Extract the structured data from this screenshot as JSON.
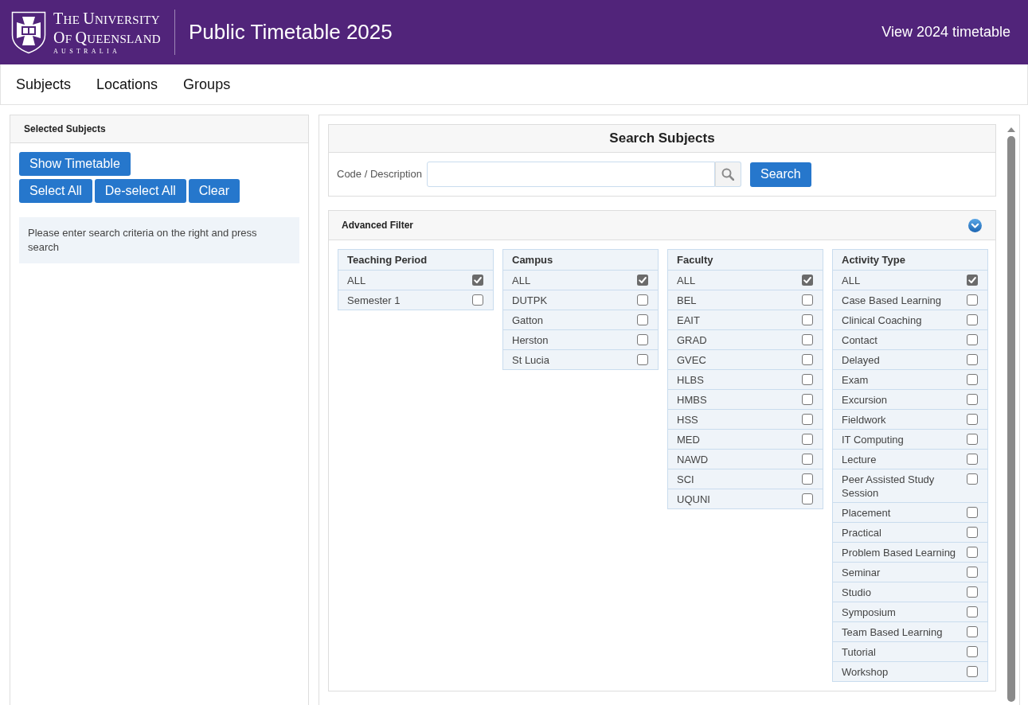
{
  "header": {
    "wordmark": [
      "THE UNIVERSITY",
      "OF QUEENSLAND",
      "AUSTRALIA"
    ],
    "title": "Public Timetable 2025",
    "link": "View 2024 timetable"
  },
  "nav": [
    "Subjects",
    "Locations",
    "Groups"
  ],
  "selected_subjects": {
    "title": "Selected Subjects",
    "button_rows": [
      [
        "Show Timetable"
      ],
      [
        "Select All",
        "De-select All",
        "Clear"
      ]
    ],
    "message": "Please enter search criteria on the right and press search"
  },
  "search": {
    "title": "Search Subjects",
    "label": "Code / Description",
    "button": "Search"
  },
  "advanced_filter": {
    "title": "Advanced Filter",
    "expanded": true,
    "filters": [
      {
        "title": "Teaching Period",
        "options": [
          {
            "label": "ALL",
            "checked": true
          },
          {
            "label": "Semester 1",
            "checked": false
          }
        ]
      },
      {
        "title": "Campus",
        "options": [
          {
            "label": "ALL",
            "checked": true
          },
          {
            "label": "DUTPK",
            "checked": false
          },
          {
            "label": "Gatton",
            "checked": false
          },
          {
            "label": "Herston",
            "checked": false
          },
          {
            "label": "St Lucia",
            "checked": false
          }
        ]
      },
      {
        "title": "Faculty",
        "options": [
          {
            "label": "ALL",
            "checked": true
          },
          {
            "label": "BEL",
            "checked": false
          },
          {
            "label": "EAIT",
            "checked": false
          },
          {
            "label": "GRAD",
            "checked": false
          },
          {
            "label": "GVEC",
            "checked": false
          },
          {
            "label": "HLBS",
            "checked": false
          },
          {
            "label": "HMBS",
            "checked": false
          },
          {
            "label": "HSS",
            "checked": false
          },
          {
            "label": "MED",
            "checked": false
          },
          {
            "label": "NAWD",
            "checked": false
          },
          {
            "label": "SCI",
            "checked": false
          },
          {
            "label": "UQUNI",
            "checked": false
          }
        ]
      },
      {
        "title": "Activity Type",
        "options": [
          {
            "label": "ALL",
            "checked": true
          },
          {
            "label": "Case Based Learning",
            "checked": false
          },
          {
            "label": "Clinical Coaching",
            "checked": false
          },
          {
            "label": "Contact",
            "checked": false
          },
          {
            "label": "Delayed",
            "checked": false
          },
          {
            "label": "Exam",
            "checked": false
          },
          {
            "label": "Excursion",
            "checked": false
          },
          {
            "label": "Fieldwork",
            "checked": false
          },
          {
            "label": "IT Computing",
            "checked": false
          },
          {
            "label": "Lecture",
            "checked": false
          },
          {
            "label": "Peer Assisted Study Session",
            "checked": false
          },
          {
            "label": "Placement",
            "checked": false
          },
          {
            "label": "Practical",
            "checked": false
          },
          {
            "label": "Problem Based Learning",
            "checked": false
          },
          {
            "label": "Seminar",
            "checked": false
          },
          {
            "label": "Studio",
            "checked": false
          },
          {
            "label": "Symposium",
            "checked": false
          },
          {
            "label": "Team Based Learning",
            "checked": false
          },
          {
            "label": "Tutorial",
            "checked": false
          },
          {
            "label": "Workshop",
            "checked": false
          }
        ]
      }
    ]
  }
}
